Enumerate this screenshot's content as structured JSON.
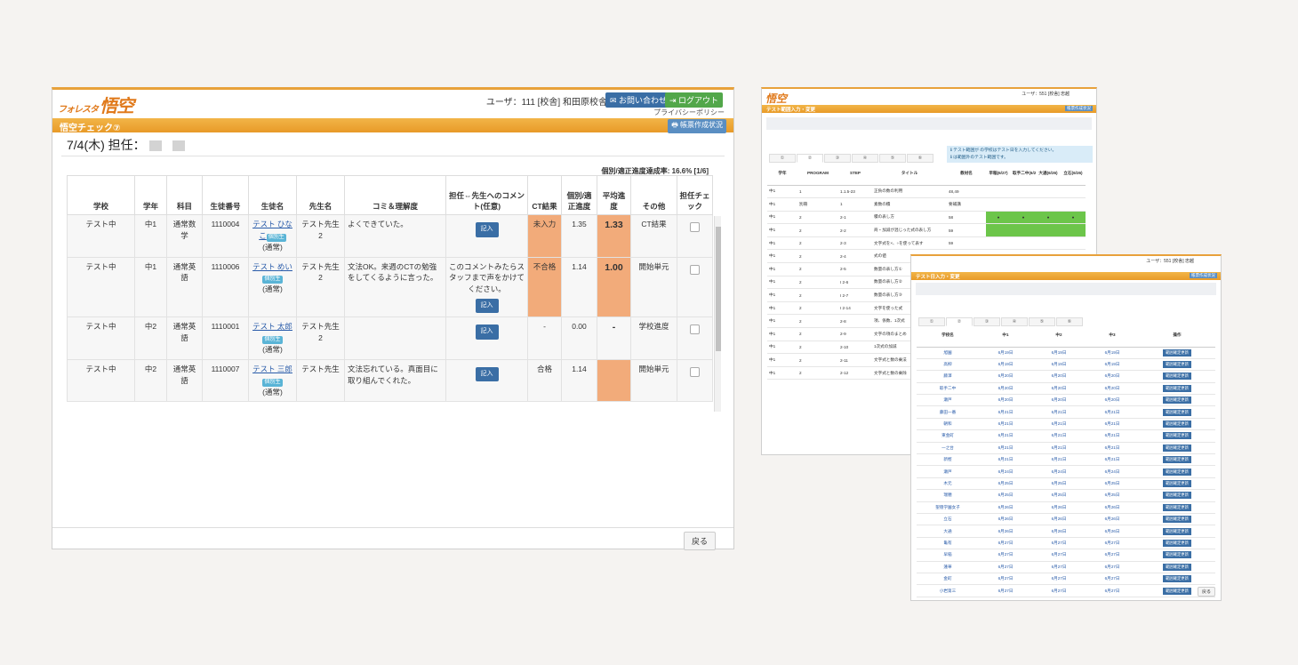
{
  "main": {
    "logo_prefix": "フォレスタ",
    "logo_main": "悟空",
    "user_info": "ユーザ：111 [校舎] 和田原校舎",
    "contact_btn": "お問い合わせ",
    "logout_btn": "ログアウト",
    "privacy": "プライバシーポリシー",
    "page_title": "悟空チェック⑦",
    "report_btn": "帳票作成状況",
    "date_line": "7/4(木) 担任：",
    "rate_text": "個別/適正進度達成率: 16.6% [1/6]",
    "headers": [
      "学校",
      "学年",
      "科目",
      "生徒番号",
      "生徒名",
      "先生名",
      "コミ＆理解度",
      "担任⇔先生へのコメント(任意)",
      "CT結果",
      "個別/適正進度",
      "平均進度",
      "その他",
      "担任チェック"
    ],
    "rows": [
      {
        "school": "テスト中",
        "grade": "中1",
        "subject": "通常数学",
        "id": "1110004",
        "student": "テスト ひなこ",
        "tag": "個別生",
        "student_suffix": "(通常)",
        "teacher": "テスト先生2",
        "comment": "よくできていた。",
        "note": "",
        "btn": "記入",
        "ct": "未入力",
        "progress": "1.35",
        "avg": "1.33",
        "other": "CT結果"
      },
      {
        "school": "テスト中",
        "grade": "中1",
        "subject": "通常英語",
        "id": "1110006",
        "student": "テスト めい",
        "tag": "個別生",
        "student_suffix": "(通常)",
        "teacher": "テスト先生2",
        "comment": "文法OK。来週のCTの勉強をしてくるように言った。",
        "note": "このコメントみたらスタッフまで声をかけてください。",
        "btn": "記入",
        "ct": "不合格",
        "progress": "1.14",
        "avg": "1.00",
        "other": "開始単元"
      },
      {
        "school": "テスト中",
        "grade": "中2",
        "subject": "通常英語",
        "id": "1110001",
        "student": "テスト 太郎",
        "tag": "個別生",
        "student_suffix": "(通常)",
        "teacher": "テスト先生2",
        "comment": "",
        "note": "",
        "btn": "記入",
        "ct": "-",
        "progress": "0.00",
        "avg": "-",
        "other": "学校進度"
      },
      {
        "school": "テスト中",
        "grade": "中2",
        "subject": "通常英語",
        "id": "1110007",
        "student": "テスト 三郎",
        "tag": "個別生",
        "student_suffix": "(通常)",
        "teacher": "テスト先生",
        "comment": "文法忘れている。真面目に取り組んでくれた。",
        "note": "",
        "btn": "記入",
        "ct": "合格",
        "progress": "1.14",
        "avg": "",
        "other": "開始単元"
      }
    ],
    "back_btn": "戻る"
  },
  "win2": {
    "logo": "悟空",
    "user": "ユーザ：551 [校舎] 忠越",
    "title": "テスト範囲入力・変更",
    "report_btn": "帳票作成状況",
    "tabs": [
      "①",
      "②",
      "③",
      "④",
      "⑤",
      "⑥"
    ],
    "note1": "テスト範囲が の学校はテスト日を入力してください。",
    "note2": "は範囲外のテスト範囲です。",
    "headers": [
      "学年",
      "PROGRAM",
      "STEP",
      "タイトル",
      "教材名",
      "早稲(6/27)",
      "取手二中(6/28)",
      "大通(6/26)",
      "立石(6/26)"
    ],
    "rows": [
      [
        "中1",
        "1",
        "1.1.5-23",
        "正負の数の利用",
        "48,49"
      ],
      [
        "中1",
        "別冊",
        "1",
        "素数の積",
        "要補講"
      ],
      [
        "中1",
        "2",
        "2-1",
        "積の表し方",
        "58"
      ],
      [
        "中1",
        "2",
        "2-2",
        "商・加減が混じった式の表し方",
        "59"
      ],
      [
        "中1",
        "2",
        "2-3",
        "文字式を×、÷を使って表す",
        "59"
      ],
      [
        "中1",
        "2",
        "2-4",
        "式の値",
        ""
      ],
      [
        "中1",
        "2",
        "2-5",
        "数量の表し方①",
        ""
      ],
      [
        "中1",
        "2",
        "I 2-6",
        "数量の表し方②",
        ""
      ],
      [
        "中1",
        "2",
        "I 2-7",
        "数量の表し方③",
        ""
      ],
      [
        "中1",
        "2",
        "I 2-14",
        "文字を使った式",
        ""
      ],
      [
        "中1",
        "2",
        "2-8",
        "項、係数、1次式",
        ""
      ],
      [
        "中1",
        "2",
        "2-9",
        "文字の項のまとめ",
        ""
      ],
      [
        "中1",
        "2",
        "2-10",
        "1次式の加減",
        ""
      ],
      [
        "中1",
        "2",
        "2-11",
        "文字式と数の乗法",
        ""
      ],
      [
        "中1",
        "2",
        "2-12",
        "文字式と数の乗除",
        ""
      ]
    ]
  },
  "win3": {
    "user": "ユーザ：551 [校舎] 忠越",
    "title": "テスト日入力・変更",
    "report_btn": "帳票作成状況",
    "tabs": [
      "①",
      "②",
      "③",
      "④",
      "⑤",
      "⑥"
    ],
    "headers": [
      "学校名",
      "中1",
      "中2",
      "中3",
      "操作"
    ],
    "btn": "範囲確定更新",
    "rows": [
      [
        "旭園",
        "6月19日",
        "6月19日",
        "6月19日"
      ],
      [
        "高柳",
        "6月19日",
        "6月19日",
        "6月19日"
      ],
      [
        "藤澤",
        "6月20日",
        "6月20日",
        "6月20日"
      ],
      [
        "取手二中",
        "6月20日",
        "6月20日",
        "6月20日"
      ],
      [
        "瀬戸",
        "6月20日",
        "6月20日",
        "6月20日"
      ],
      [
        "藤田一番",
        "6月21日",
        "6月21日",
        "6月21日"
      ],
      [
        "朝和",
        "6月21日",
        "6月21日",
        "6月21日"
      ],
      [
        "東金町",
        "6月21日",
        "6月21日",
        "6月21日"
      ],
      [
        "一之台",
        "6月21日",
        "6月21日",
        "6月21日"
      ],
      [
        "新樫",
        "6月21日",
        "6月21日",
        "6月21日"
      ],
      [
        "瀬戸",
        "6月24日",
        "6月24日",
        "6月24日"
      ],
      [
        "木元",
        "6月25日",
        "6月25日",
        "6月25日"
      ],
      [
        "瑞穂",
        "6月25日",
        "6月25日",
        "6月25日"
      ],
      [
        "聖徳学園女子",
        "6月26日",
        "6月26日",
        "6月26日"
      ],
      [
        "立石",
        "6月26日",
        "6月26日",
        "6月26日"
      ],
      [
        "大通",
        "6月26日",
        "6月26日",
        "6月26日"
      ],
      [
        "亀有",
        "6月27日",
        "6月27日",
        "6月27日"
      ],
      [
        "早稲",
        "6月27日",
        "6月27日",
        "6月27日"
      ],
      [
        "蓮華",
        "6月27日",
        "6月27日",
        "6月27日"
      ],
      [
        "金町",
        "6月27日",
        "6月27日",
        "6月27日"
      ],
      [
        "小岩第三",
        "6月27日",
        "6月27日",
        "6月27日"
      ]
    ],
    "back_btn": "戻る"
  }
}
